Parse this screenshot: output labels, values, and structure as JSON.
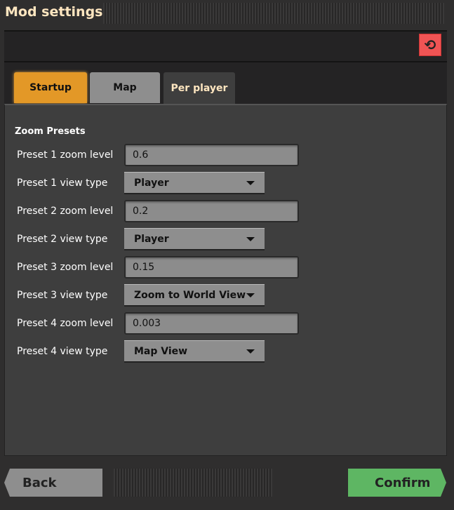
{
  "window": {
    "title": "Mod settings"
  },
  "reset": {
    "icon": "reset-icon",
    "color": "#f05454"
  },
  "tabs": [
    {
      "label": "Startup",
      "color": "#e39827"
    },
    {
      "label": "Map",
      "color": "#8e8e8e"
    },
    {
      "label": "Per player",
      "color": "#3d3d3d",
      "selected": true
    }
  ],
  "section": {
    "title": "Zoom Presets"
  },
  "settings": [
    {
      "label": "Preset 1 zoom level",
      "type": "textfield",
      "value": "0.6"
    },
    {
      "label": "Preset 1 view type",
      "type": "dropdown",
      "value": "Player"
    },
    {
      "label": "Preset 2 zoom level",
      "type": "textfield",
      "value": "0.2"
    },
    {
      "label": "Preset 2 view type",
      "type": "dropdown",
      "value": "Player"
    },
    {
      "label": "Preset 3 zoom level",
      "type": "textfield",
      "value": "0.15"
    },
    {
      "label": "Preset 3 view type",
      "type": "dropdown",
      "value": "Zoom to World View"
    },
    {
      "label": "Preset 4 zoom level",
      "type": "textfield",
      "value": "0.003"
    },
    {
      "label": "Preset 4 view type",
      "type": "dropdown",
      "value": "Map View"
    }
  ],
  "footer": {
    "back": "Back",
    "confirm": "Confirm",
    "confirm_color": "#5eb663"
  }
}
